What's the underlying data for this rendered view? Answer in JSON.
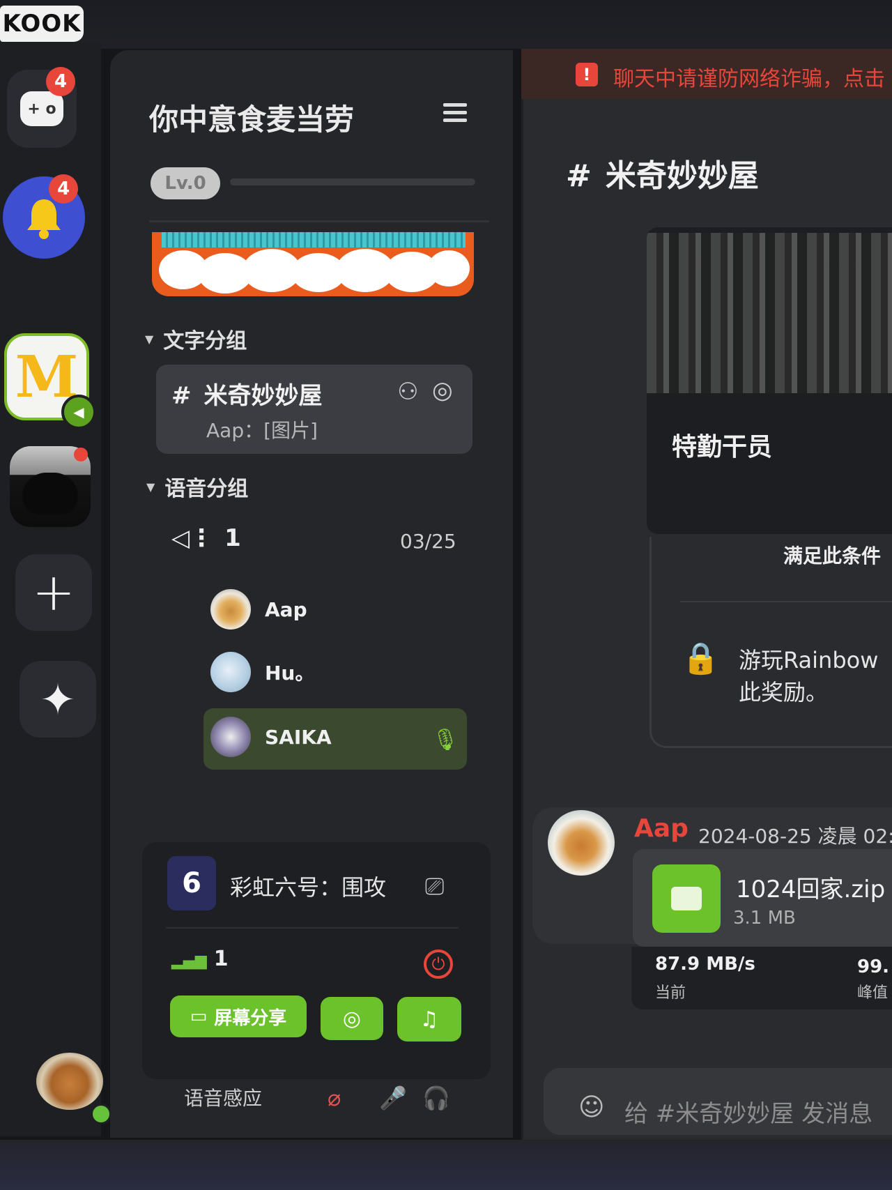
{
  "app": {
    "logo_text": "KOOK"
  },
  "rail": {
    "dm_badge": "4",
    "bell_badge": "4",
    "add_symbol": "+",
    "ai_symbol": "✦"
  },
  "server": {
    "name": "你中意食麦当劳",
    "level": "Lv.0"
  },
  "text_group": {
    "label": "文字分组",
    "channel": {
      "name": "米奇妙妙屋",
      "last_message": "Aap：[图片]"
    }
  },
  "voice_group": {
    "label": "语音分组",
    "channel": {
      "name": "1",
      "date": "03/25"
    },
    "members": [
      {
        "name": "Aap"
      },
      {
        "name": "Hu。"
      },
      {
        "name": "SAIKA"
      }
    ]
  },
  "voice_card": {
    "game_icon": "6",
    "game_name": "彩虹六号：围攻",
    "channel": "1",
    "share_button": "屏幕分享",
    "voice_sense": "语音感应"
  },
  "chat": {
    "warning": "聊天中请谨防网络诈骗，点击",
    "channel_title": "米奇妙妙屋",
    "embed": {
      "title": "特勤干员",
      "reward_head": "满足此条件",
      "reward_text_line1": "游玩Rainbow",
      "reward_text_line2": "此奖励。"
    },
    "message": {
      "author": "Aap",
      "time": "2024-08-25 凌晨 02:",
      "file_name": "1024回家.zip",
      "file_size": "3.1 MB",
      "speed_current": "87.9 MB/s",
      "speed_current_label": "当前",
      "speed_peak": "99.",
      "speed_peak_label": "峰值"
    },
    "input_placeholder": "给 #米奇妙妙屋 发消息"
  },
  "colors": {
    "accent_green": "#6cc22a",
    "warning_red": "#e8463a",
    "badge_red": "#e8463a",
    "bell_blue": "#3e4fd1"
  }
}
